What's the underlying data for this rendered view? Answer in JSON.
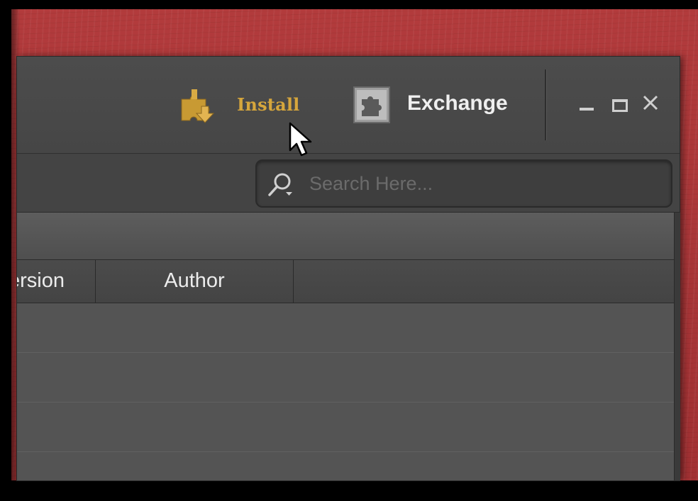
{
  "toolbar": {
    "install_label": "Install",
    "install_icon": "puzzle-download-icon",
    "exchange_label": "Exchange",
    "exchange_icon": "puzzle-box-icon"
  },
  "window_controls": {
    "minimize": "minimize-icon",
    "maximize": "maximize-icon",
    "close": "close-icon"
  },
  "search": {
    "placeholder": "Search Here...",
    "value": "",
    "icon": "search-icon"
  },
  "table": {
    "columns": [
      "ersion",
      "Author"
    ],
    "rows": [
      [],
      [],
      [],
      []
    ]
  },
  "colors": {
    "install_accent": "#d6a63c",
    "background_wall": "#ad3537",
    "panel": "#454545"
  }
}
